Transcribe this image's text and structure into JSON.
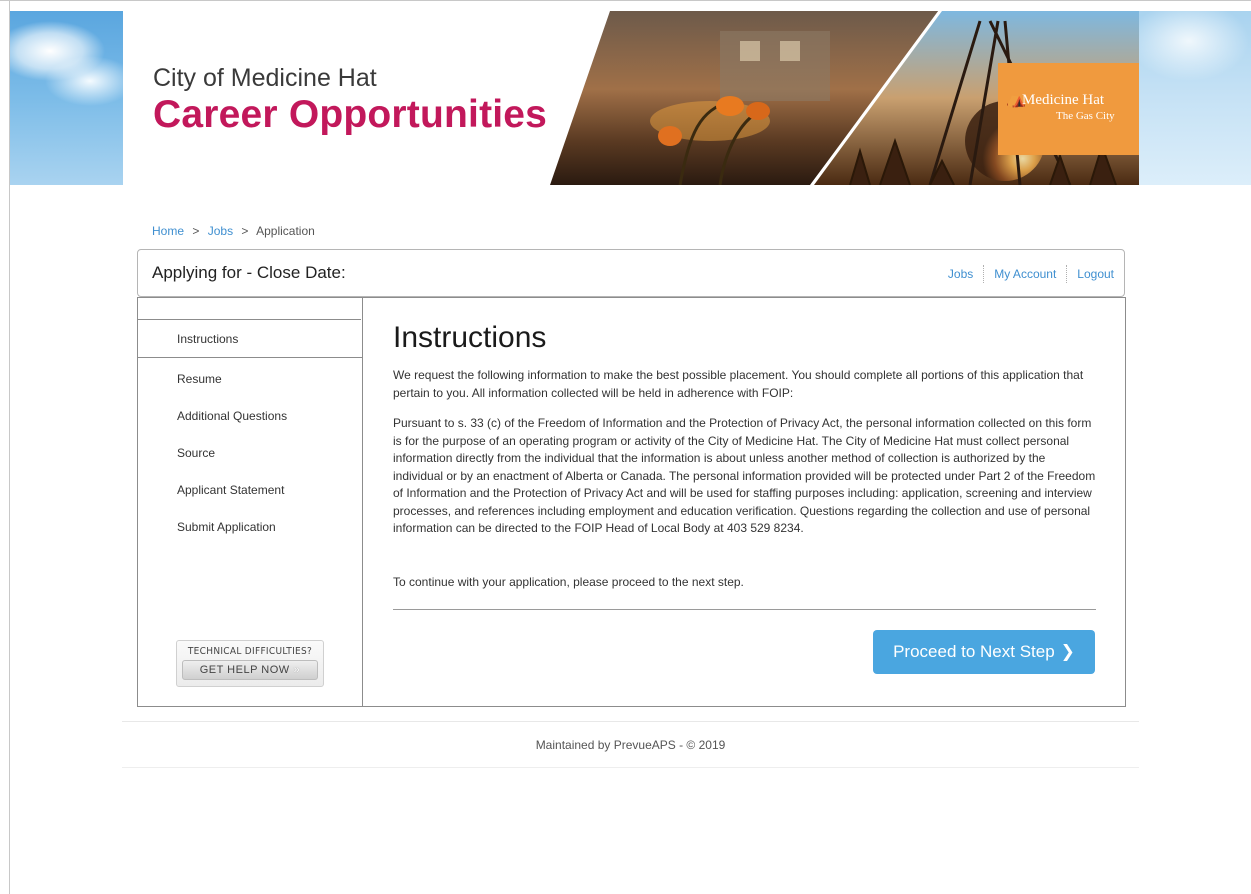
{
  "banner": {
    "city": "City of Medicine Hat",
    "title": "Career Opportunities",
    "logo_name": "Medicine Hat",
    "logo_sub": "The Gas City"
  },
  "breadcrumb": {
    "home": "Home",
    "jobs": "Jobs",
    "current": "Application",
    "separator": ">"
  },
  "header": {
    "title": "Applying for - Close Date:",
    "links": {
      "jobs": "Jobs",
      "account": "My Account",
      "logout": "Logout"
    }
  },
  "sidebar": {
    "items": [
      {
        "label": "Instructions"
      },
      {
        "label": "Resume"
      },
      {
        "label": "Additional Questions"
      },
      {
        "label": "Source"
      },
      {
        "label": "Applicant Statement"
      },
      {
        "label": "Submit Application"
      }
    ],
    "help": {
      "top": "TECHNICAL DIFFICULTIES?",
      "button": "GET HELP NOW"
    }
  },
  "main": {
    "heading": "Instructions",
    "paragraphs": [
      "We request the following information to make the best possible placement. You should complete all portions of this application that pertain to you. All information collected will be held in adherence with FOIP:",
      "Pursuant to s. 33 (c) of the Freedom of Information and the Protection of Privacy Act, the personal information collected on this form is for the purpose of an operating program or activity of the City of Medicine Hat. The City of Medicine Hat must collect personal information directly from the individual that the information is about unless another method of collection is authorized by the individual or by an enactment of Alberta or Canada. The personal information provided will be protected under Part 2 of the Freedom of Information and the Protection of Privacy Act and will be used for staffing purposes including: application, screening and interview processes, and references including employment and education verification. Questions regarding the collection and use of personal information can be directed to the FOIP Head of Local Body at 403 529 8234.",
      "To continue with your application, please proceed to the next step."
    ],
    "next_button": "Proceed to Next Step"
  },
  "footer": {
    "text": "Maintained by PrevueAPS - © 2019"
  },
  "colors": {
    "title_magenta": "#c2185b",
    "link_blue": "#3f8fd0",
    "button_blue": "#4aa6e0",
    "logo_orange": "#f09a3e"
  }
}
